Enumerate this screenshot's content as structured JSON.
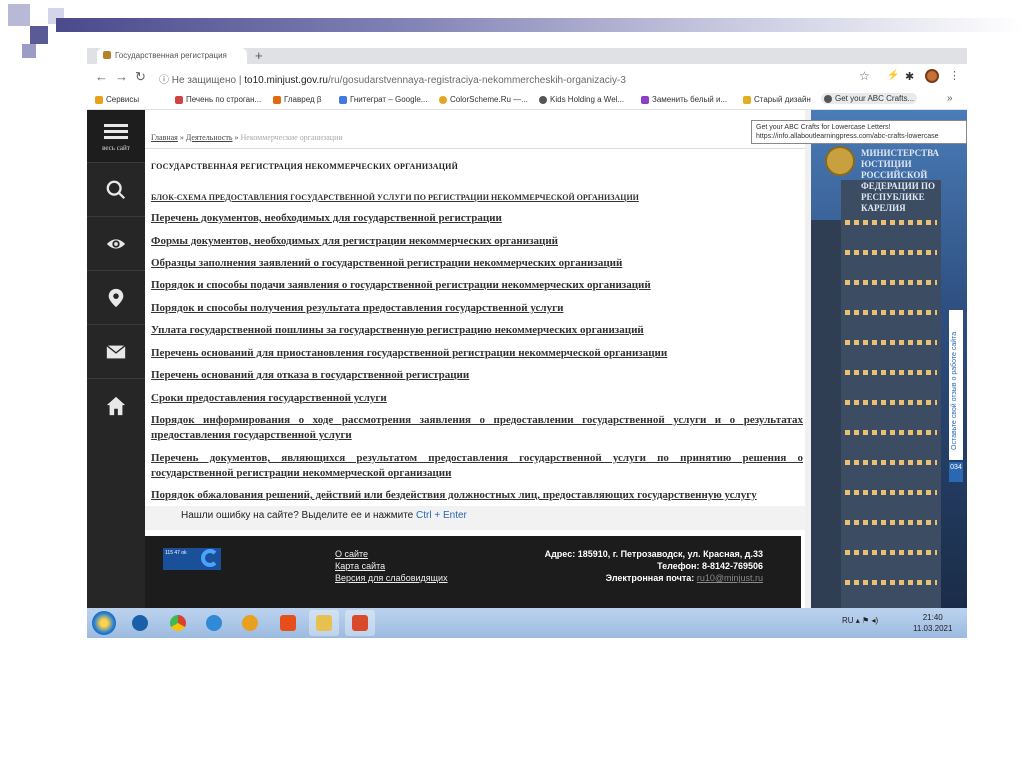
{
  "browser": {
    "tab_title": "Государственная регистрация",
    "new_tab_icon": "plus-icon",
    "address": {
      "security": "Не защищено",
      "host": "to10.minjust.gov.ru",
      "path": "/ru/gosudarstvennaya-registraciya-nekommercheskih-organizaciy-3"
    },
    "bookmarks": [
      {
        "label": "Сервисы",
        "color": "#e6a11c"
      },
      {
        "label": "Печень по строган...",
        "color": "#d04444"
      },
      {
        "label": "Главред β",
        "color": "#e06a10"
      },
      {
        "label": "Гнитеграт – Google...",
        "color": "#3f7be0"
      },
      {
        "label": "ColorScheme.Ru —...",
        "color": "#e8a420"
      },
      {
        "label": "Kids Holding a Wel...",
        "color": "#555555"
      },
      {
        "label": "Заменить белый и...",
        "color": "#8a3fc8"
      },
      {
        "label": "Старый дизайн",
        "color": "#e0b020"
      },
      {
        "label": "Get your ABC Crafts...",
        "color": "#555555"
      }
    ],
    "more_bookmarks": "»",
    "tooltip": {
      "line1": "Get your ABC Crafts for Lowercase Letters!",
      "line2": "https://info.allaboutlearningpress.com/abc-crafts-lowercase"
    }
  },
  "sidebar": {
    "menu_label": "весь сайт",
    "items": [
      {
        "icon": "search-icon"
      },
      {
        "icon": "eye-icon"
      },
      {
        "icon": "map-pin-icon"
      },
      {
        "icon": "mail-icon"
      },
      {
        "icon": "home-icon"
      }
    ]
  },
  "breadcrumbs": {
    "home": "Главная",
    "sep1": "»",
    "section": "Деятельность",
    "sep2": "»",
    "current": "Некоммерческие организации"
  },
  "page": {
    "title": "ГОСУДАРСТВЕННАЯ РЕГИСТРАЦИЯ НЕКОММЕРЧЕСКИХ ОРГАНИЗАЦИЙ",
    "block_link": "БЛОК-СХЕМА ПРЕДОСТАВЛЕНИЯ ГОСУДАРСТВЕННОЙ УСЛУГИ ПО РЕГИСТРАЦИИ НЕКОММЕРЧЕСКОЙ ОРГАНИЗАЦИИ",
    "links": [
      "Перечень документов, необходимых для государственной регистрации",
      "Формы документов, необходимых для регистрации некоммерческих организаций",
      "Образцы заполнения заявлений о государственной регистрации некоммерческих организаций",
      "Порядок и способы подачи заявления о государственной регистрации некоммерческих организаций",
      "Порядок и способы получения результата предоставления государственной услуги",
      "Уплата государственной пошлины за государственную регистрацию некоммерческих организаций",
      "Перечень оснований для приостановления государственной регистрации некоммерческой организации",
      "Перечень оснований для отказа в государственной регистрации",
      "Сроки предоставления государственной услуги",
      "Порядок информирования о ходе рассмотрения заявления о предоставлении государственной услуги и о результатах предоставления государственной услуги",
      "Перечень документов, являющихся результатом предоставления государственной услуги по принятию решения о государственной регистрации некоммерческой организации",
      "Порядок обжалования решений, действий или бездействия должностных лиц, предоставляющих государственную услугу"
    ]
  },
  "error_bar": {
    "text": "Нашли ошибку на сайте? Выделите ее и нажмите",
    "shortcut": "Ctrl + Enter"
  },
  "footer": {
    "logo_text": "115 47 ok",
    "links": [
      "О сайте",
      "Карта сайта",
      "Версия для слабовидящих"
    ],
    "address": "Адрес: 185910, г. Петрозаводск, ул. Красная, д.33",
    "phone": "Телефон: 8-8142-769506",
    "email_label": "Электронная почта:",
    "email": "ru10@minjust.ru"
  },
  "banner": {
    "ministry_lines": [
      "МИНИСТЕРСТВА",
      "ЮСТИЦИИ",
      "РОССИЙСКОЙ",
      "ФЕДЕРАЦИИ ПО",
      "РЕСПУБЛИКЕ",
      "КАРЕЛИЯ"
    ],
    "feedback_text": "Оставьте свой отзыв о работе сайта",
    "feedback_count": "034"
  },
  "taskbar": {
    "apps": [
      {
        "icon": "start-icon"
      },
      {
        "icon": "tv-icon",
        "color": "#1a5fa8"
      },
      {
        "icon": "chrome-icon",
        "color": "#d8402f"
      },
      {
        "icon": "mail-app-icon",
        "color": "#2f8ad8"
      },
      {
        "icon": "media-player-icon",
        "color": "#e8a020"
      },
      {
        "icon": "mi-icon",
        "color": "#e84e1b"
      },
      {
        "icon": "folder-icon",
        "color": "#e8c050"
      },
      {
        "icon": "presentation-icon",
        "color": "#d84a2a"
      }
    ],
    "lang": "RU",
    "time": "21:40",
    "date": "11.03.2021"
  }
}
